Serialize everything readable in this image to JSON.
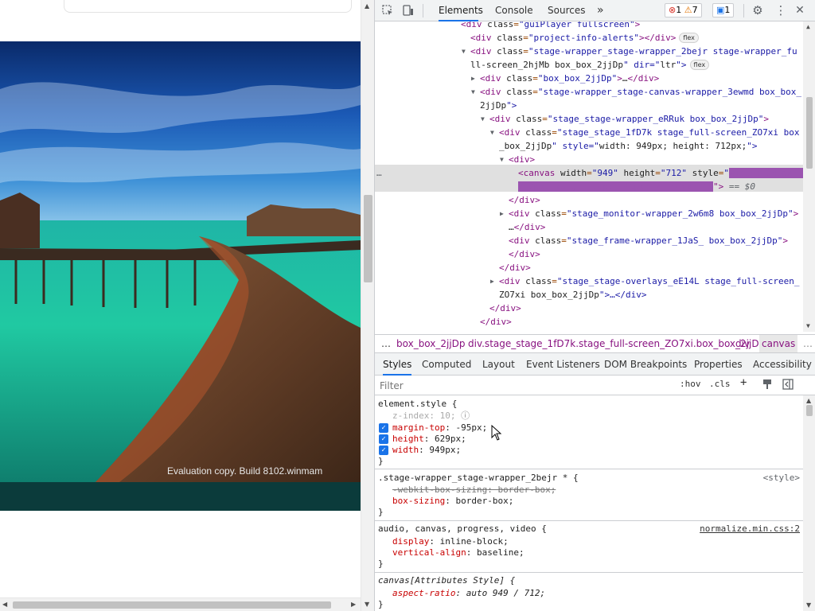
{
  "page": {
    "top_card_text": "…",
    "watermark": "Evaluation copy. Build 8102.winmam"
  },
  "devtools": {
    "tabs": [
      "Elements",
      "Console",
      "Sources"
    ],
    "more_tabs": "»",
    "error_count": "1",
    "warning_count": "7",
    "message_count": "1",
    "dom_lines": [
      {
        "indent": 0,
        "text": "<div class=\"guiPlayer fullscreen\">"
      },
      {
        "indent": 1,
        "text": "<div class=\"project-info-alerts\"></div>",
        "chip": "flex"
      },
      {
        "indent": 1,
        "text": "<div class=\"stage-wrapper_stage-wrapper_2bejr stage-wrapper_fu",
        "tri": "down"
      },
      {
        "indent": 1,
        "text": "ll-screen_2hjMb box_box_2jjDp\" dir=\"ltr\">",
        "chip": "flex",
        "cont": true
      },
      {
        "indent": 2,
        "text": "<div class=\"box_box_2jjDp\">…</div>",
        "tri": "right"
      },
      {
        "indent": 2,
        "text": "<div class=\"stage-wrapper_stage-canvas-wrapper_3ewmd box_box_",
        "tri": "down"
      },
      {
        "indent": 2,
        "text": "2jjDp\">",
        "cont": true
      },
      {
        "indent": 3,
        "text": "<div class=\"stage_stage-wrapper_eRRuk box_box_2jjDp\">",
        "tri": "down"
      },
      {
        "indent": 4,
        "text": "<div class=\"stage_stage_1fD7k stage_full-screen_ZO7xi box",
        "tri": "down"
      },
      {
        "indent": 4,
        "text": "_box_2jjDp\" style=\"width: 949px; height: 712px;\">",
        "cont": true
      },
      {
        "indent": 5,
        "text": "<div>",
        "tri": "down"
      },
      {
        "indent": 6,
        "text": "<canvas width=\"949\" height=\"712\" style=\"",
        "selected": true
      },
      {
        "indent": 6,
        "text": "\"> == $0",
        "selected": true,
        "cont": true
      },
      {
        "indent": 5,
        "text": "</div>"
      },
      {
        "indent": 5,
        "text": "<div class=\"stage_monitor-wrapper_2w6m8 box_box_2jjDp\">",
        "tri": "right"
      },
      {
        "indent": 5,
        "text": "…</div>",
        "cont": true
      },
      {
        "indent": 5,
        "text": "<div class=\"stage_frame-wrapper_1JaS_ box_box_2jjDp\">"
      },
      {
        "indent": 5,
        "text": "</div>"
      },
      {
        "indent": 4,
        "text": "</div>"
      },
      {
        "indent": 4,
        "text": "<div class=\"stage_stage-overlays_eE14L stage_full-screen_",
        "tri": "right"
      },
      {
        "indent": 4,
        "text": "ZO7xi box_box_2jjDp\">…</div>",
        "cont": true
      },
      {
        "indent": 3,
        "text": "</div>"
      },
      {
        "indent": 2,
        "text": "</div>"
      },
      {
        "indent": 1,
        "text": "</div>"
      }
    ],
    "breadcrumbs": [
      "…",
      "box_box_2jjDp",
      "div.stage_stage_1fD7k.stage_full-screen_ZO7xi.box_box_2jjDp",
      "div",
      "canvas"
    ],
    "panel_tabs": [
      "Styles",
      "Computed",
      "Layout",
      "Event Listeners",
      "DOM Breakpoints",
      "Properties",
      "Accessibility"
    ],
    "filter_placeholder": "Filter",
    "hov": ":hov",
    "cls": ".cls",
    "styles": {
      "element_style": {
        "selector": "element.style {",
        "props": [
          {
            "name": "z-index",
            "value": "10;",
            "disabled": true
          },
          {
            "name": "margin-top",
            "value": "-95px;"
          },
          {
            "name": "height",
            "value": "629px;"
          },
          {
            "name": "width",
            "value": "949px;"
          }
        ]
      },
      "rule2": {
        "selector": ".stage-wrapper_stage-wrapper_2bejr * {",
        "source": "<style>",
        "props": [
          {
            "name": "-webkit-box-sizing",
            "value": "border-box;",
            "struck": true
          },
          {
            "name": "box-sizing",
            "value": "border-box;"
          }
        ]
      },
      "rule3": {
        "selector": "audio, canvas, progress, video {",
        "source": "normalize.min.css:2",
        "props": [
          {
            "name": "display",
            "value": "inline-block;"
          },
          {
            "name": "vertical-align",
            "value": "baseline;"
          }
        ]
      },
      "rule4": {
        "selector": "canvas[Attributes Style] {",
        "props": [
          {
            "name": "aspect-ratio",
            "value": "auto 949 / 712;"
          }
        ]
      },
      "close": "}"
    }
  },
  "colors": {
    "accent": "#1a73e8",
    "tag": "#881280",
    "attr_name": "#994500",
    "attr_value": "#1a1aa6",
    "prop_name": "#c80000",
    "highlight": "#9b54b0"
  }
}
